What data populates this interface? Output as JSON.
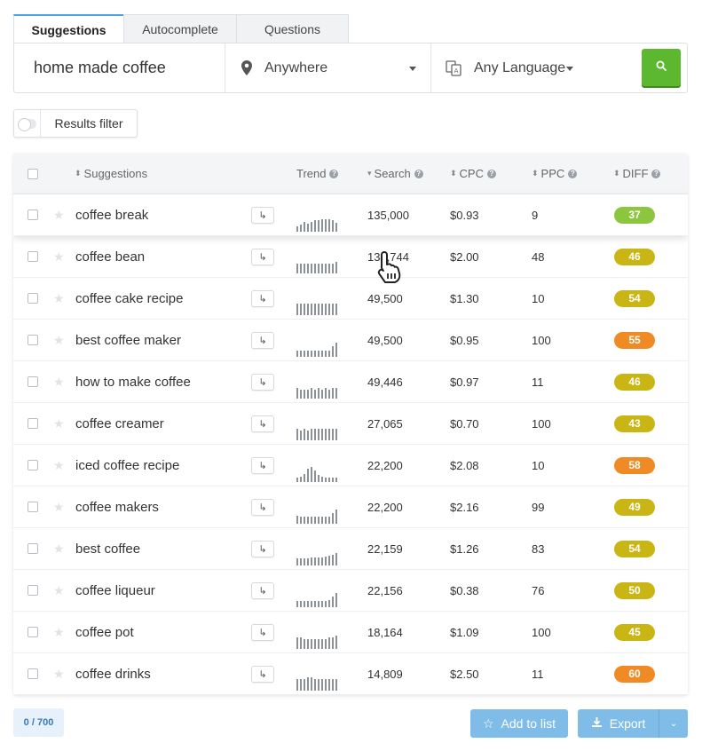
{
  "tabs": [
    "Suggestions",
    "Autocomplete",
    "Questions"
  ],
  "search": {
    "query": "home made coffee",
    "location": "Anywhere",
    "language": "Any Language",
    "location_icon": "map-pin-icon",
    "language_icon": "translate-icon",
    "button_icon": "search-icon"
  },
  "filter": {
    "label": "Results filter",
    "enabled": false
  },
  "table": {
    "headers": {
      "suggestions": "Suggestions",
      "trend": "Trend",
      "search": "Search",
      "cpc": "CPC",
      "ppc": "PPC",
      "diff": "DIFF"
    },
    "rows": [
      {
        "keyword": "coffee break",
        "search": "135,000",
        "cpc": "$0.93",
        "ppc": "9",
        "diff": "37",
        "color": "#8cc63f",
        "trend": [
          6,
          8,
          11,
          9,
          11,
          13,
          13,
          14,
          14,
          14,
          13,
          10
        ]
      },
      {
        "keyword": "coffee bean",
        "search": "134,744",
        "cpc": "$2.00",
        "ppc": "48",
        "diff": "46",
        "color": "#c9b514",
        "trend": [
          11,
          11,
          11,
          11,
          11,
          11,
          11,
          11,
          11,
          11,
          11,
          13
        ]
      },
      {
        "keyword": "coffee cake recipe",
        "search": "49,500",
        "cpc": "$1.30",
        "ppc": "10",
        "diff": "54",
        "color": "#c9b514",
        "trend": [
          13,
          13,
          13,
          13,
          13,
          13,
          13,
          13,
          13,
          13,
          13,
          13
        ]
      },
      {
        "keyword": "best coffee maker",
        "search": "49,500",
        "cpc": "$0.95",
        "ppc": "100",
        "diff": "55",
        "color": "#f08a24",
        "trend": [
          7,
          7,
          7,
          7,
          7,
          7,
          7,
          7,
          7,
          7,
          12,
          16
        ]
      },
      {
        "keyword": "how to make coffee",
        "search": "49,446",
        "cpc": "$0.97",
        "ppc": "11",
        "diff": "46",
        "color": "#c9b514",
        "trend": [
          12,
          10,
          10,
          10,
          12,
          10,
          12,
          10,
          12,
          10,
          12,
          12
        ]
      },
      {
        "keyword": "coffee creamer",
        "search": "27,065",
        "cpc": "$0.70",
        "ppc": "100",
        "diff": "43",
        "color": "#c9b514",
        "trend": [
          13,
          11,
          13,
          11,
          13,
          13,
          13,
          13,
          13,
          13,
          13,
          13
        ]
      },
      {
        "keyword": "iced coffee recipe",
        "search": "22,200",
        "cpc": "$2.08",
        "ppc": "10",
        "diff": "58",
        "color": "#f08a24",
        "trend": [
          5,
          6,
          9,
          15,
          17,
          13,
          8,
          6,
          5,
          5,
          5,
          5
        ]
      },
      {
        "keyword": "coffee makers",
        "search": "22,200",
        "cpc": "$2.16",
        "ppc": "99",
        "diff": "49",
        "color": "#c9b514",
        "trend": [
          9,
          8,
          8,
          8,
          8,
          8,
          8,
          8,
          8,
          8,
          12,
          16
        ]
      },
      {
        "keyword": "best coffee",
        "search": "22,159",
        "cpc": "$1.26",
        "ppc": "83",
        "diff": "54",
        "color": "#c9b514",
        "trend": [
          8,
          8,
          8,
          8,
          9,
          9,
          9,
          9,
          10,
          11,
          12,
          14
        ]
      },
      {
        "keyword": "coffee liqueur",
        "search": "22,156",
        "cpc": "$0.38",
        "ppc": "76",
        "diff": "50",
        "color": "#c9b514",
        "trend": [
          7,
          7,
          7,
          7,
          7,
          7,
          7,
          7,
          7,
          8,
          12,
          16
        ]
      },
      {
        "keyword": "coffee pot",
        "search": "18,164",
        "cpc": "$1.09",
        "ppc": "100",
        "diff": "45",
        "color": "#c9b514",
        "trend": [
          13,
          13,
          11,
          11,
          11,
          11,
          11,
          11,
          11,
          13,
          13,
          15
        ]
      },
      {
        "keyword": "coffee drinks",
        "search": "14,809",
        "cpc": "$2.50",
        "ppc": "11",
        "diff": "60",
        "color": "#f08a24",
        "trend": [
          13,
          13,
          13,
          15,
          15,
          13,
          13,
          13,
          13,
          13,
          13,
          13
        ]
      }
    ]
  },
  "footer": {
    "counter": "0 / 700",
    "add_to_list": "Add to list",
    "export": "Export"
  }
}
